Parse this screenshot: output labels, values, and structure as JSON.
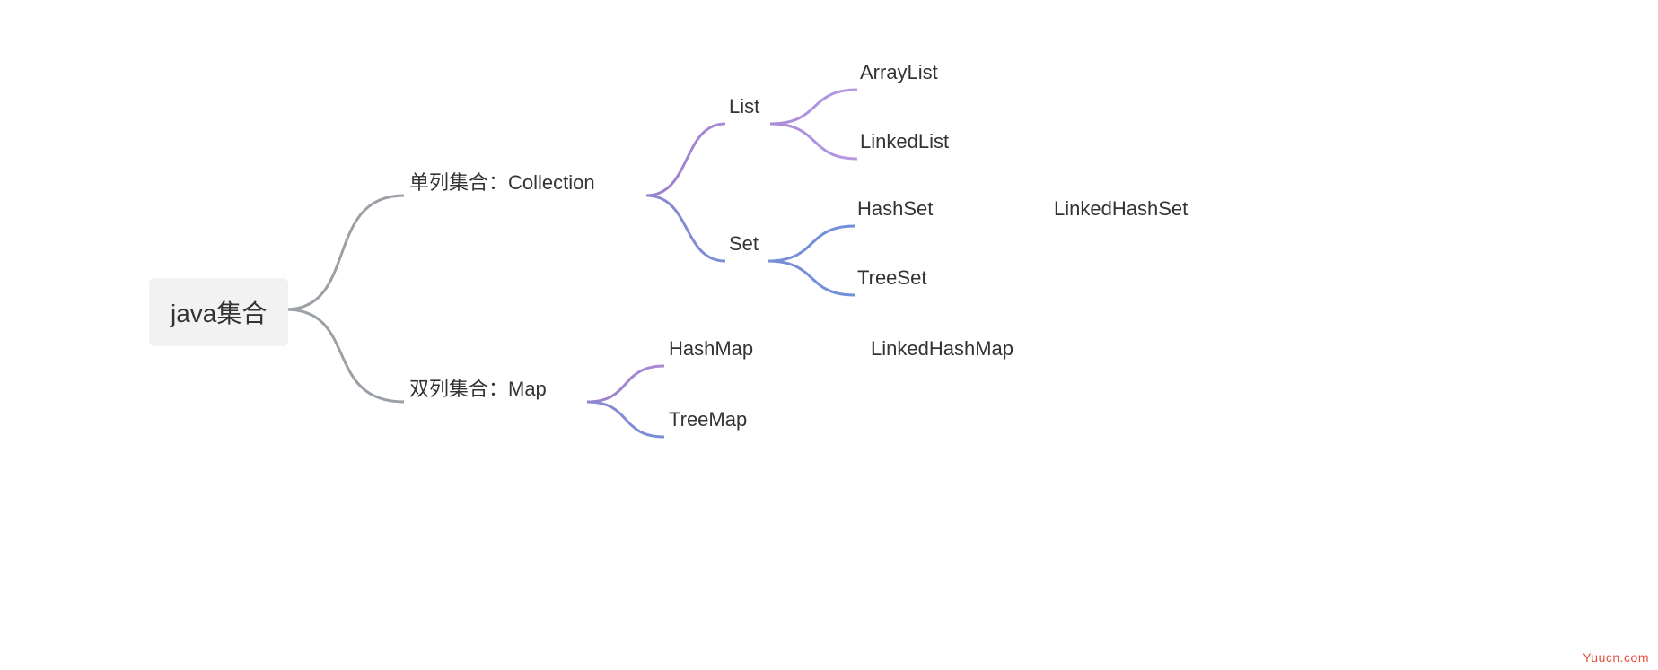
{
  "watermark": "Yuucn.com",
  "mindmap": {
    "root": {
      "label": "java集合"
    },
    "branches": {
      "collection": {
        "label": "单列集合：Collection",
        "children": {
          "list": {
            "label": "List",
            "children": {
              "arraylist": {
                "label": "ArrayList"
              },
              "linkedlist": {
                "label": "LinkedList"
              }
            }
          },
          "set": {
            "label": "Set",
            "children": {
              "hashset": {
                "label": "HashSet",
                "children": {
                  "linkedhashset": {
                    "label": "LinkedHashSet"
                  }
                }
              },
              "treeset": {
                "label": "TreeSet"
              }
            }
          }
        }
      },
      "map": {
        "label": "双列集合：Map",
        "children": {
          "hashmap": {
            "label": "HashMap",
            "children": {
              "linkedhashmap": {
                "label": "LinkedHashMap"
              }
            }
          },
          "treemap": {
            "label": "TreeMap"
          }
        }
      }
    }
  }
}
